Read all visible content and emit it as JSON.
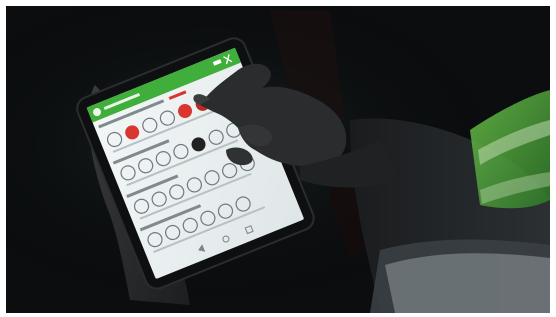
{
  "scene": {
    "background_color": "#0b0d0e",
    "screen_color": "#e9eef0",
    "app_bar_color": "#3fae3a",
    "accent_red": "#d8362f"
  },
  "app": {
    "header_title": "",
    "section_labels": [
      "",
      "",
      "",
      ""
    ]
  },
  "icons": {
    "app_logo": "green-app-icon",
    "selected_option": "red-circle-icon",
    "option_set": "round-outline-icon"
  }
}
